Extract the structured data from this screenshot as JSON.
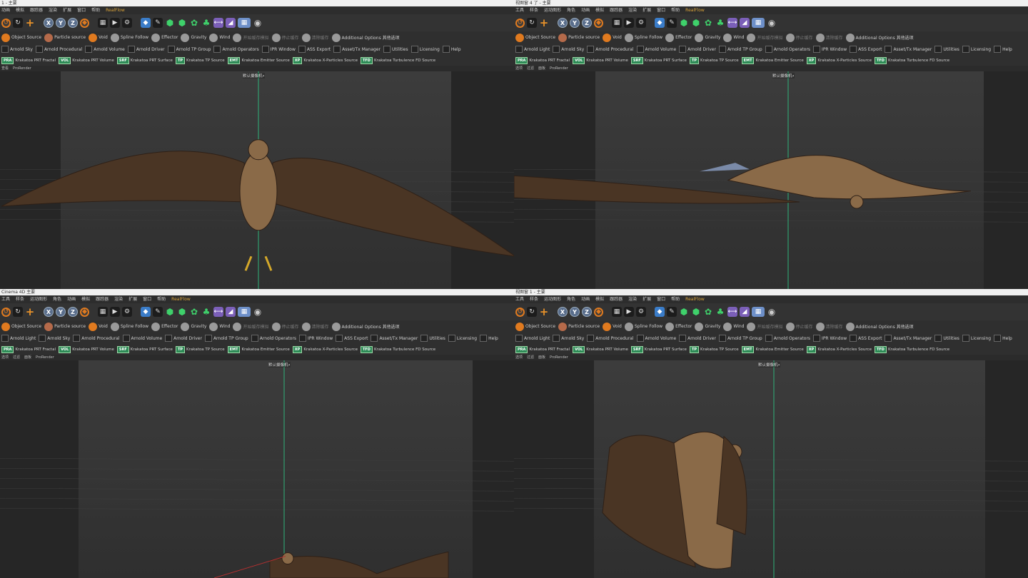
{
  "panes": [
    {
      "id": "tl",
      "title": "1 - 主要",
      "viewport_label": "默认摄像机•",
      "menu": [
        "动画",
        "模拟",
        "跟踪器",
        "渲染",
        "扩展",
        "窗口",
        "帮助"
      ],
      "realflow": "RealFlow",
      "toolbar2": [
        "Object Source",
        "Particle source",
        "Void",
        "Spline Follow",
        "Effector",
        "Gravity",
        "Wind",
        "开始缓存模拟",
        "停止缓存",
        "清除缓存",
        "Additional Options 其他选项"
      ],
      "toolbar3": [
        "Arnold Sky",
        "Arnold Procedural",
        "Arnold Volume",
        "Arnold Driver",
        "Arnold TP Group",
        "Arnold Operators",
        "IPR Window",
        "ASS Export",
        "Asset/Tx Manager",
        "Utilities",
        "Licensing",
        "Help"
      ],
      "toolbar4": [
        "Krakatoa PRT Fractal",
        "Krakatoa PRT Volume",
        "Krakatoa PRT Surface",
        "Krakatoa TP Source",
        "Krakatoa Emitter Source",
        "Krakatoa X-Particles Source",
        "Krakatoa Turbulence FD Source"
      ],
      "vphead": [
        "查看",
        "ProRender"
      ]
    },
    {
      "id": "tr",
      "title": "视图窗 4 了 - 主要",
      "viewport_label": "默认摄像机•",
      "menu": [
        "工具",
        "样条",
        "运动图形",
        "角色",
        "动画",
        "模拟",
        "跟踪器",
        "渲染",
        "扩展",
        "窗口",
        "帮助"
      ],
      "realflow": "RealFlow",
      "toolbar2": [
        "Object Source",
        "Particle source",
        "Void",
        "Spline Follow",
        "Effector",
        "Gravity",
        "Wind",
        "开始缓存模拟",
        "停止缓存",
        "清除缓存",
        "Additional Options 其他选项"
      ],
      "toolbar3": [
        "Arnold Light",
        "Arnold Sky",
        "Arnold Procedural",
        "Arnold Volume",
        "Arnold Driver",
        "Arnold TP Group",
        "Arnold Operators",
        "IPR Window",
        "ASS Export",
        "Asset/Tx Manager",
        "Utilities",
        "Licensing",
        "Help"
      ],
      "toolbar4": [
        "Krakatoa PRT Fractal",
        "Krakatoa PRT Volume",
        "Krakatoa PRT Surface",
        "Krakatoa TP Source",
        "Krakatoa Emitter Source",
        "Krakatoa X-Particles Source",
        "Krakatoa Turbulence FD Source"
      ],
      "vphead": [
        "选项",
        "过滤",
        "面板",
        "ProRender"
      ]
    },
    {
      "id": "bl",
      "title": "Cinema 4D 主要",
      "viewport_label": "默认摄像机•",
      "menu": [
        "工具",
        "样条",
        "运动图形",
        "角色",
        "动画",
        "模拟",
        "跟踪器",
        "渲染",
        "扩展",
        "窗口",
        "帮助"
      ],
      "realflow": "RealFlow",
      "toolbar2": [
        "Object Source",
        "Particle source",
        "Void",
        "Spline Follow",
        "Effector",
        "Gravity",
        "Wind",
        "开始缓存模拟",
        "停止缓存",
        "清除缓存",
        "Additional Options 其他选项"
      ],
      "toolbar3": [
        "Arnold Light",
        "Arnold Sky",
        "Arnold Procedural",
        "Arnold Volume",
        "Arnold Driver",
        "Arnold TP Group",
        "Arnold Operators",
        "IPR Window",
        "ASS Export",
        "Asset/Tx Manager",
        "Utilities",
        "Licensing",
        "Help"
      ],
      "toolbar4": [
        "Krakatoa PRT Fractal",
        "Krakatoa PRT Volume",
        "Krakatoa PRT Surface",
        "Krakatoa TP Source",
        "Krakatoa Emitter Source",
        "Krakatoa X-Particles Source",
        "Krakatoa Turbulence FD Source"
      ],
      "vphead": [
        "选项",
        "过滤",
        "面板",
        "ProRender"
      ]
    },
    {
      "id": "br",
      "title": "视图窗 1 - 主要",
      "viewport_label": "默认摄像机•",
      "menu": [
        "工具",
        "样条",
        "运动图形",
        "角色",
        "动画",
        "模拟",
        "跟踪器",
        "渲染",
        "扩展",
        "窗口",
        "帮助"
      ],
      "realflow": "RealFlow",
      "toolbar2": [
        "Object Source",
        "Particle source",
        "Void",
        "Spline Follow",
        "Effector",
        "Gravity",
        "Wind",
        "开始缓存模拟",
        "停止缓存",
        "清除缓存",
        "Additional Options 其他选项"
      ],
      "toolbar3": [
        "Arnold Light",
        "Arnold Sky",
        "Arnold Procedural",
        "Arnold Volume",
        "Arnold Driver",
        "Arnold TP Group",
        "Arnold Operators",
        "IPR Window",
        "ASS Export",
        "Asset/Tx Manager",
        "Utilities",
        "Licensing",
        "Help"
      ],
      "toolbar4": [
        "Krakatoa PRT Fractal",
        "Krakatoa PRT Volume",
        "Krakatoa PRT Surface",
        "Krakatoa TP Source",
        "Krakatoa Emitter Source",
        "Krakatoa X-Particles Source",
        "Krakatoa Turbulence FD Source"
      ],
      "vphead": [
        "选项",
        "过滤",
        "面板",
        "ProRender"
      ]
    }
  ],
  "icons": [
    "undo-icon",
    "redo-icon",
    "move-icon",
    "x-axis-icon",
    "y-axis-icon",
    "z-axis-icon",
    "coordinate-icon",
    "render-region-icon",
    "render-view-icon",
    "render-settings-icon",
    "cube-icon",
    "pen-icon",
    "subdivision-icon",
    "array-icon",
    "spline-icon",
    "mograph-icon",
    "deformer-icon",
    "floor-icon",
    "camera-icon",
    "light-icon"
  ],
  "toolbar4_badges": [
    "PRA",
    "VOL",
    "SRF",
    "TP",
    "EMT",
    "XP",
    "TFD"
  ]
}
